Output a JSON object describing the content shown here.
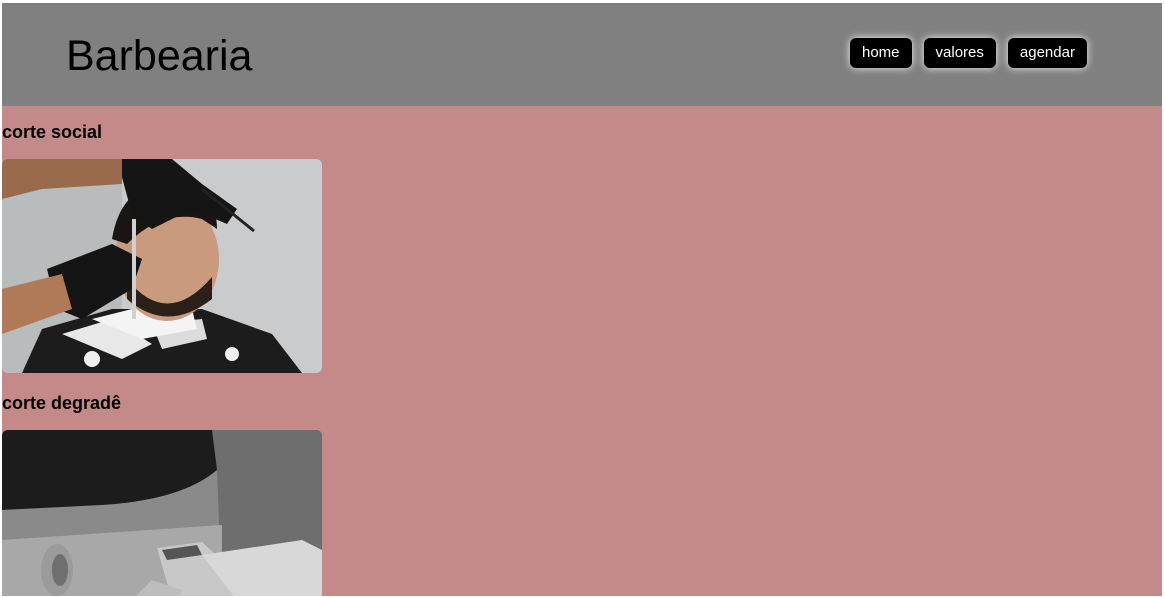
{
  "header": {
    "brand": "Barbearia",
    "nav": [
      {
        "label": "home"
      },
      {
        "label": "valores"
      },
      {
        "label": "agendar"
      }
    ]
  },
  "services": [
    {
      "title": "corte social",
      "image": "photo-barber-beard-trim"
    },
    {
      "title": "corte degradê",
      "image": "photo-fade-haircut-clippers"
    }
  ],
  "colors": {
    "header_bg": "#808080",
    "page_bg": "#c48a8a",
    "button_bg": "#000000",
    "button_text": "#ffffff"
  }
}
